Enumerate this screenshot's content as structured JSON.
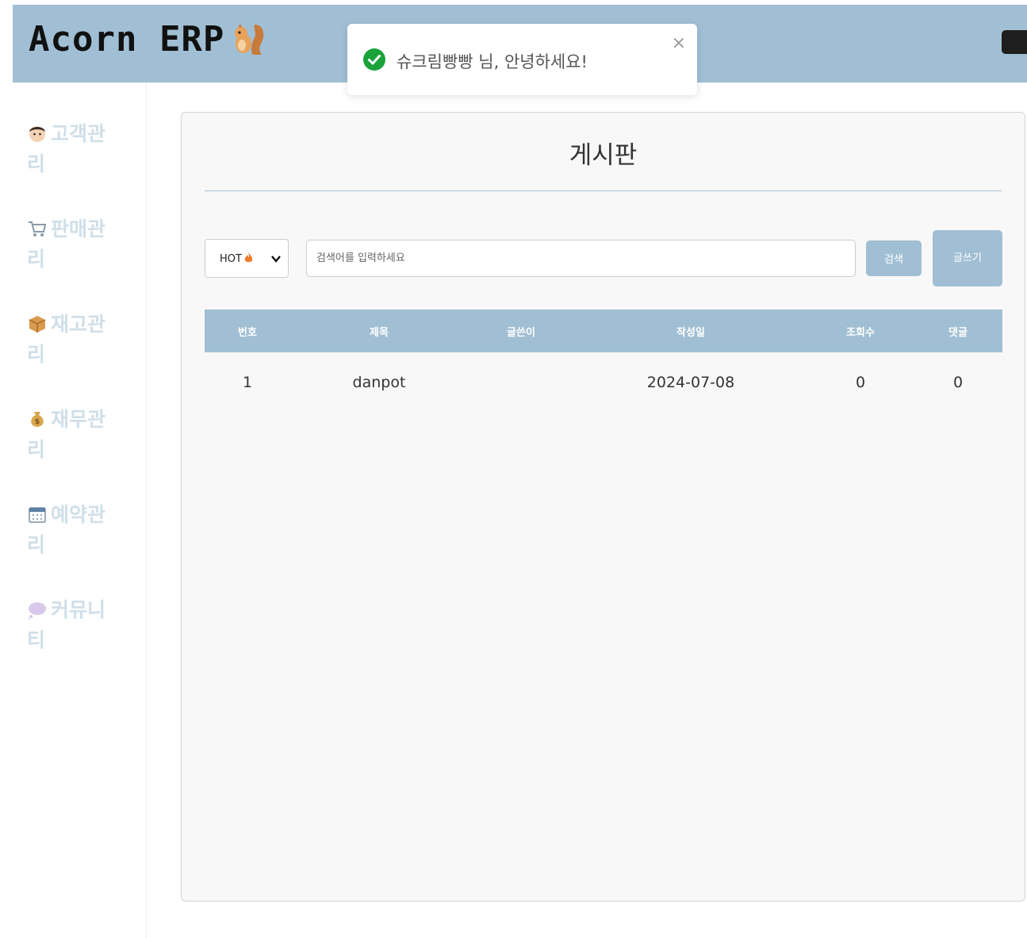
{
  "app": {
    "logo_text": "Acorn ERP"
  },
  "toast": {
    "message": "슈크림빵빵 님, 안녕하세요!",
    "close": "×"
  },
  "sidebar": {
    "items": [
      {
        "label": "고객관리",
        "icon": "customer-face-icon"
      },
      {
        "label": "판매관리",
        "icon": "shopping-cart-icon"
      },
      {
        "label": "재고관리",
        "icon": "package-box-icon"
      },
      {
        "label": "재무관리",
        "icon": "money-bag-icon"
      },
      {
        "label": "예약관리",
        "icon": "calendar-icon"
      },
      {
        "label": "커뮤니티",
        "icon": "speech-bubble-icon"
      }
    ]
  },
  "board": {
    "title": "게시판",
    "filter": {
      "selected": "HOT",
      "icon": "fire-icon"
    },
    "search": {
      "placeholder": "검색어를 입력하세요",
      "value": "",
      "button": "검색"
    },
    "write_button": "글쓰기",
    "columns": [
      "번호",
      "제목",
      "글쓴이",
      "작성일",
      "조회수",
      "댓글"
    ],
    "rows": [
      {
        "no": "1",
        "title": "danpot",
        "author": "",
        "date": "2024-07-08",
        "views": "0",
        "comments": "0"
      }
    ]
  },
  "colors": {
    "header": "#a1bfd4",
    "sidebar_text": "#cfdfe9",
    "success": "#1aa33b"
  }
}
